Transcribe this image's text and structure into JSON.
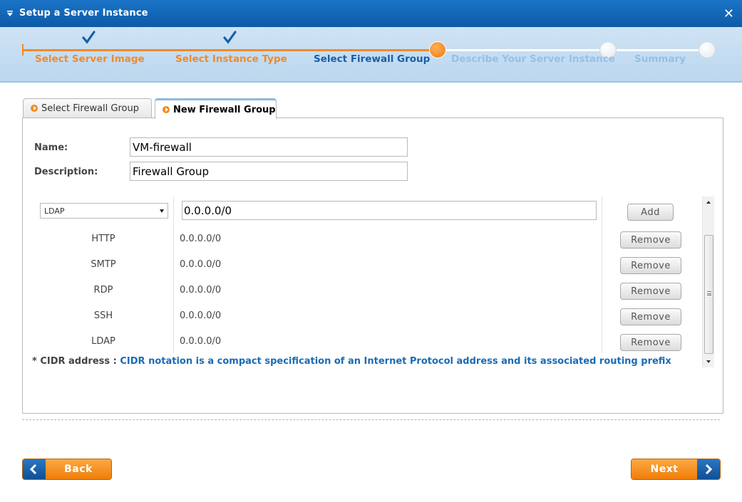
{
  "window": {
    "title": "Setup a Server Instance",
    "close_icon": "close-icon",
    "close_glyph": "✕"
  },
  "wizard": {
    "steps": [
      {
        "label": "Select Server Image",
        "state": "done"
      },
      {
        "label": "Select Instance Type",
        "state": "done"
      },
      {
        "label": "Select Firewall Group",
        "state": "current"
      },
      {
        "label": "Describe Your Server Instance",
        "state": "todo"
      },
      {
        "label": "Summary",
        "state": "todo"
      }
    ]
  },
  "tabs": [
    {
      "label": "Select Firewall Group",
      "active": false
    },
    {
      "label": "New Firewall Group",
      "active": true
    }
  ],
  "form": {
    "name_label": "Name:",
    "name_value": "VM-firewall",
    "description_label": "Description:",
    "description_value": "Firewall Group"
  },
  "rules": {
    "selected_protocol": "LDAP",
    "cidr_value": "0.0.0.0/0",
    "add_label": "Add",
    "remove_label": "Remove",
    "rows": [
      {
        "protocol": "HTTP",
        "cidr": "0.0.0.0/0"
      },
      {
        "protocol": "SMTP",
        "cidr": "0.0.0.0/0"
      },
      {
        "protocol": "RDP",
        "cidr": "0.0.0.0/0"
      },
      {
        "protocol": "SSH",
        "cidr": "0.0.0.0/0"
      },
      {
        "protocol": "LDAP",
        "cidr": "0.0.0.0/0"
      }
    ]
  },
  "cidr_note": {
    "key": "* CIDR address : ",
    "text": "CIDR notation is a compact specification of an Internet Protocol address and its associated routing prefix"
  },
  "nav": {
    "back_label": "Back",
    "next_label": "Next"
  },
  "colors": {
    "title_bar": "#1a74c7",
    "accent_orange": "#ef8a2c",
    "current_step_blue": "#1560a8",
    "pending_step_blue": "#93c1e8",
    "nav_blue": "#114f95"
  }
}
